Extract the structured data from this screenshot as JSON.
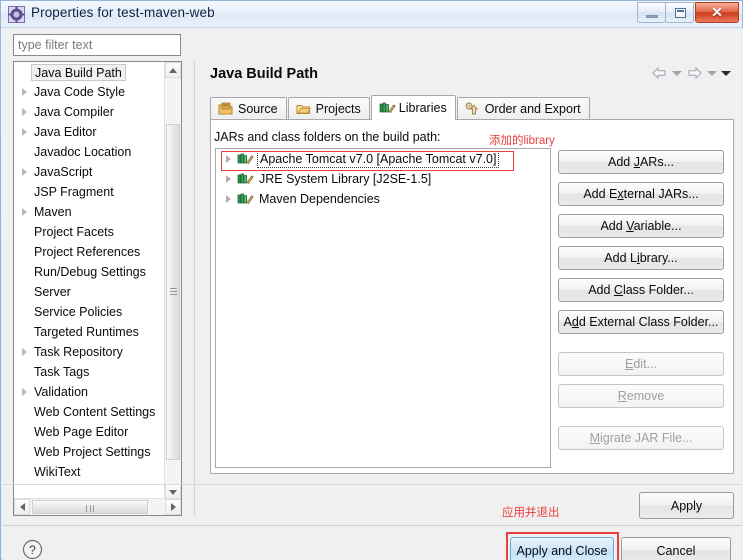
{
  "window": {
    "title": "Properties for test-maven-web",
    "icon": "properties-icon",
    "buttons": {
      "minimize": "minimize-icon",
      "maximize": "maximize-icon",
      "close": "✕"
    }
  },
  "filter": {
    "placeholder": "type filter text",
    "value": ""
  },
  "sidebar": {
    "items": [
      {
        "label": "Java Build Path",
        "expandable": false,
        "selected": true
      },
      {
        "label": "Java Code Style",
        "expandable": true,
        "selected": false
      },
      {
        "label": "Java Compiler",
        "expandable": true,
        "selected": false
      },
      {
        "label": "Java Editor",
        "expandable": true,
        "selected": false
      },
      {
        "label": "Javadoc Location",
        "expandable": false,
        "selected": false
      },
      {
        "label": "JavaScript",
        "expandable": true,
        "selected": false
      },
      {
        "label": "JSP Fragment",
        "expandable": false,
        "selected": false
      },
      {
        "label": "Maven",
        "expandable": true,
        "selected": false
      },
      {
        "label": "Project Facets",
        "expandable": false,
        "selected": false
      },
      {
        "label": "Project References",
        "expandable": false,
        "selected": false
      },
      {
        "label": "Run/Debug Settings",
        "expandable": false,
        "selected": false
      },
      {
        "label": "Server",
        "expandable": false,
        "selected": false
      },
      {
        "label": "Service Policies",
        "expandable": false,
        "selected": false
      },
      {
        "label": "Targeted Runtimes",
        "expandable": false,
        "selected": false
      },
      {
        "label": "Task Repository",
        "expandable": true,
        "selected": false
      },
      {
        "label": "Task Tags",
        "expandable": false,
        "selected": false
      },
      {
        "label": "Validation",
        "expandable": true,
        "selected": false
      },
      {
        "label": "Web Content Settings",
        "expandable": false,
        "selected": false
      },
      {
        "label": "Web Page Editor",
        "expandable": false,
        "selected": false
      },
      {
        "label": "Web Project Settings",
        "expandable": false,
        "selected": false
      },
      {
        "label": "WikiText",
        "expandable": false,
        "selected": false
      }
    ]
  },
  "page": {
    "title": "Java Build Path",
    "nav": {
      "back": "back-arrow-icon",
      "forward": "forward-arrow-icon",
      "menu": "view-menu-icon"
    },
    "tabs": [
      {
        "label": "Source",
        "icon": "source-folder-icon",
        "active": false
      },
      {
        "label": "Projects",
        "icon": "projects-folder-icon",
        "active": false
      },
      {
        "label": "Libraries",
        "icon": "libraries-icon",
        "active": true
      },
      {
        "label": "Order and Export",
        "icon": "order-export-icon",
        "active": false
      }
    ],
    "group_label": "JARs and class folders on the build path:",
    "libraries": [
      {
        "label": "Apache Tomcat v7.0 [Apache Tomcat v7.0]",
        "icon": "library-icon",
        "focused": true
      },
      {
        "label": "JRE System Library [J2SE-1.5]",
        "icon": "library-icon",
        "focused": false
      },
      {
        "label": "Maven Dependencies",
        "icon": "library-icon",
        "focused": false
      }
    ],
    "side_buttons": [
      {
        "label": "Add JARs...",
        "mnemonic": "J",
        "enabled": true
      },
      {
        "label": "Add External JARs...",
        "mnemonic": "x",
        "enabled": true
      },
      {
        "label": "Add Variable...",
        "mnemonic": "V",
        "enabled": true
      },
      {
        "label": "Add Library...",
        "mnemonic": "i",
        "enabled": true
      },
      {
        "label": "Add Class Folder...",
        "mnemonic": "C",
        "enabled": true
      },
      {
        "label": "Add External Class Folder...",
        "mnemonic": "d",
        "enabled": true
      },
      {
        "label": "Edit...",
        "mnemonic": "E",
        "enabled": false
      },
      {
        "label": "Remove",
        "mnemonic": "R",
        "enabled": false
      },
      {
        "label": "Migrate JAR File...",
        "mnemonic": "M",
        "enabled": false
      }
    ]
  },
  "annotations": [
    {
      "text": "添加的library",
      "color": "#e8403a",
      "target": "library-row-highlight"
    },
    {
      "text": "应用并退出",
      "color": "#e8403a",
      "target": "apply-and-close-button"
    }
  ],
  "footer": {
    "help": "help-icon",
    "apply": {
      "label": "Apply",
      "mnemonic": "A"
    },
    "apply_and_close": "Apply and Close",
    "cancel": "Cancel"
  },
  "colors": {
    "accent_red": "#e8403a",
    "title_gradient_top": "#f3f8fd",
    "dialog_bg": "#f0f0f0",
    "selected_button_blue": "#cfe8fb"
  }
}
